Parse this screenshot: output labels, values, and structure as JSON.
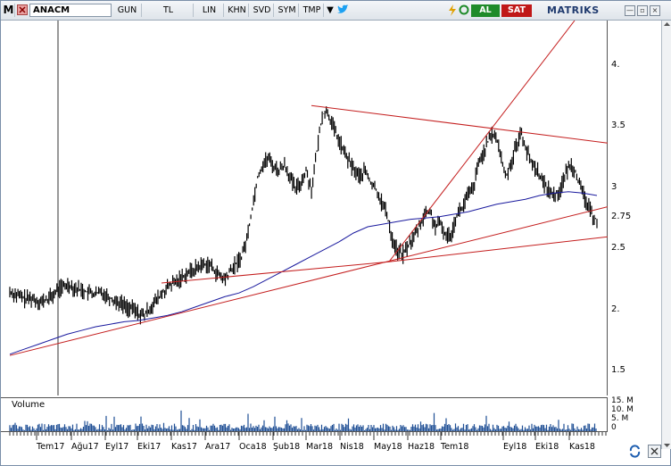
{
  "toolbar": {
    "app_letter": "M",
    "symbol": "ANACM",
    "period": "GUN",
    "currency": "TL",
    "scale": "LIN",
    "items": [
      "KHN",
      "SVD",
      "SYM",
      "TMP"
    ],
    "buy_label": "AL",
    "sell_label": "SAT",
    "brand": "MATRIKS"
  },
  "price_axis": {
    "ticks": [
      "4.",
      "3.5",
      "3",
      "2.75",
      "2.5",
      "2.",
      "1.5"
    ]
  },
  "volume_panel": {
    "label": "Volume",
    "ticks": [
      "15. M",
      "10. M",
      "5. M",
      "0"
    ]
  },
  "time_axis": {
    "labels": [
      "Tem17",
      "Ağu17",
      "Eyl17",
      "Eki17",
      "Kas17",
      "Ara17",
      "Oca18",
      "Şub18",
      "Mar18",
      "Nis18",
      "May18",
      "Haz18",
      "Tem18",
      "Eyl18",
      "Eki18",
      "Kas18"
    ]
  },
  "colors": {
    "price": "#000000",
    "moving_average": "#1a1a9e",
    "trendline": "#c41e1e",
    "volume": "#1f4f95"
  },
  "chart_data": {
    "type": "line",
    "ylim": [
      1.35,
      4.35
    ],
    "price_series": [
      2.18,
      2.16,
      2.14,
      2.12,
      2.13,
      2.11,
      2.1,
      2.12,
      2.15,
      2.2,
      2.22,
      2.24,
      2.21,
      2.2,
      2.18,
      2.17,
      2.16,
      2.18,
      2.15,
      2.12,
      2.1,
      2.08,
      2.05,
      2.04,
      2.0,
      1.99,
      2.05,
      2.1,
      2.15,
      2.2,
      2.24,
      2.26,
      2.3,
      2.33,
      2.35,
      2.38,
      2.4,
      2.4,
      2.35,
      2.3,
      2.28,
      2.35,
      2.4,
      2.46,
      2.6,
      2.85,
      3.1,
      3.2,
      3.25,
      3.18,
      3.15,
      3.2,
      3.1,
      3.0,
      3.05,
      3.15,
      3.0,
      3.3,
      3.6,
      3.62,
      3.5,
      3.4,
      3.3,
      3.22,
      3.15,
      3.1,
      3.15,
      3.05,
      3.0,
      2.9,
      2.8,
      2.6,
      2.5,
      2.48,
      2.55,
      2.62,
      2.7,
      2.8,
      2.82,
      2.7,
      2.72,
      2.62,
      2.65,
      2.8,
      2.85,
      2.95,
      3.0,
      3.2,
      3.3,
      3.4,
      3.45,
      3.3,
      3.1,
      3.2,
      3.35,
      3.45,
      3.3,
      3.2,
      3.15,
      3.05,
      3.0,
      2.95,
      2.98,
      3.1,
      3.2,
      3.15,
      3.0,
      2.9,
      2.8,
      2.75
    ],
    "moving_average": [
      1.68,
      1.72,
      1.76,
      1.8,
      1.84,
      1.87,
      1.9,
      1.92,
      1.94,
      1.95,
      1.97,
      1.99,
      2.02,
      2.06,
      2.1,
      2.14,
      2.17,
      2.22,
      2.28,
      2.34,
      2.4,
      2.46,
      2.52,
      2.58,
      2.65,
      2.7,
      2.72,
      2.74,
      2.76,
      2.77,
      2.78,
      2.8,
      2.82,
      2.85,
      2.88,
      2.9,
      2.92,
      2.95,
      2.97,
      2.98,
      2.97,
      2.95
    ],
    "volume_range": [
      0,
      15000000
    ]
  }
}
